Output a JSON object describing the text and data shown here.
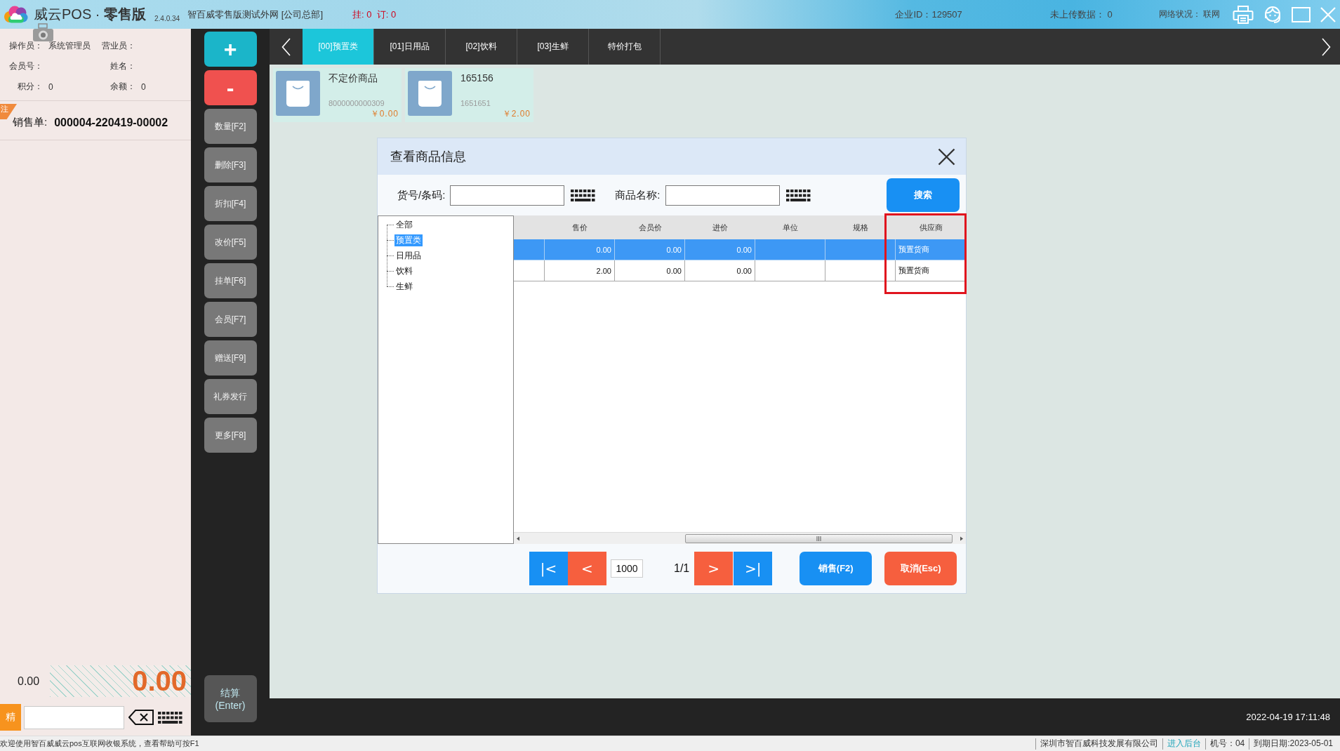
{
  "title_bar": {
    "app_name": "威云POS · **零售版**",
    "version": "2.4.0.34",
    "store": "智百威零售版测试外网 [公司总部]",
    "pending": "挂: 0  订: 0",
    "company_id": "企业ID：129507",
    "unuploaded": "未上传数据： 0",
    "network": "网络状况： 联网"
  },
  "left_panel": {
    "info": [
      {
        "label": "操作员：",
        "value": "系统管理员"
      },
      {
        "label": "营业员："
      },
      {
        "label": "会员号："
      },
      {
        "label": "姓名："
      },
      {
        "label": "积分：",
        "value": "0"
      },
      {
        "label": "余额：",
        "value": "0"
      }
    ],
    "order_tag": "注",
    "order_label": "销售单:",
    "order_number": "000004-220419-00002",
    "quantity_total": "0.00",
    "amount_total": "0.00",
    "mode_button": "精"
  },
  "function_buttons": [
    {
      "label": "+",
      "kind": "add"
    },
    {
      "label": "-",
      "kind": "remove"
    },
    {
      "label": "数量[F2]",
      "kind": "function"
    },
    {
      "label": "删除[F3]",
      "kind": "function"
    },
    {
      "label": "折扣[F4]",
      "kind": "function"
    },
    {
      "label": "改价[F5]",
      "kind": "function"
    },
    {
      "label": "挂单[F6]",
      "kind": "function"
    },
    {
      "label": "会员[F7]",
      "kind": "function"
    },
    {
      "label": "赠送[F9]",
      "kind": "function"
    },
    {
      "label": "礼券发行",
      "kind": "function"
    },
    {
      "label": "更多[F8]",
      "kind": "function"
    }
  ],
  "checkout_button": "结算\n(Enter)",
  "category_tabs": [
    {
      "label": "[00]预置类",
      "selected": true
    },
    {
      "label": "[01]日用品",
      "selected": false
    },
    {
      "label": "[02]饮料",
      "selected": false
    },
    {
      "label": "[03]生鲜",
      "selected": false
    },
    {
      "label": "特价打包",
      "selected": false
    }
  ],
  "products": [
    {
      "name": "不定价商品",
      "code": "8000000000309",
      "price": "￥0.00"
    },
    {
      "name": "165156",
      "code": "1651651",
      "price": "￥2.00"
    }
  ],
  "dialog": {
    "title": "查看商品信息",
    "search_fields": [
      {
        "label": "货号/条码:"
      },
      {
        "label": "商品名称:"
      }
    ],
    "search_button": "搜索",
    "categories": [
      {
        "label": "全部",
        "selected": false
      },
      {
        "label": "预置类",
        "selected": true
      },
      {
        "label": "日用品",
        "selected": false
      },
      {
        "label": "饮料",
        "selected": false
      },
      {
        "label": "生鲜",
        "selected": false
      }
    ],
    "table": {
      "columns": [
        {
          "label": "售价",
          "highlighted": false
        },
        {
          "label": "会员价",
          "highlighted": false
        },
        {
          "label": "进价",
          "highlighted": false
        },
        {
          "label": "单位",
          "highlighted": false
        },
        {
          "label": "规格",
          "highlighted": false
        },
        {
          "label": "供应商",
          "highlighted": true
        }
      ],
      "rows": [
        {
          "selected": true,
          "sale_price": "0.00",
          "member_price": "0.00",
          "cost_price": "0.00",
          "supplier": "预置货商"
        },
        {
          "selected": false,
          "sale_price": "2.00",
          "member_price": "0.00",
          "cost_price": "0.00",
          "supplier": "预置货商"
        }
      ]
    },
    "pager": {
      "first": "|<",
      "previous": "<",
      "page_size": "1000",
      "page": "1/1",
      "next": ">",
      "last": ">|"
    },
    "actions": [
      {
        "label": "销售(F2)",
        "kind": "confirm"
      },
      {
        "label": "取消(Esc)",
        "kind": "cancel"
      }
    ]
  },
  "clock": "2022-04-19 17:11:48",
  "status_bar": {
    "welcome": "欢迎使用智百威威云pos互联网收银系统，查看帮助可按F1",
    "company": "深圳市智百威科技发展有限公司",
    "backend_link": "进入后台",
    "terminal": "机号：04",
    "expiry": "到期日期:2023-05-01"
  }
}
